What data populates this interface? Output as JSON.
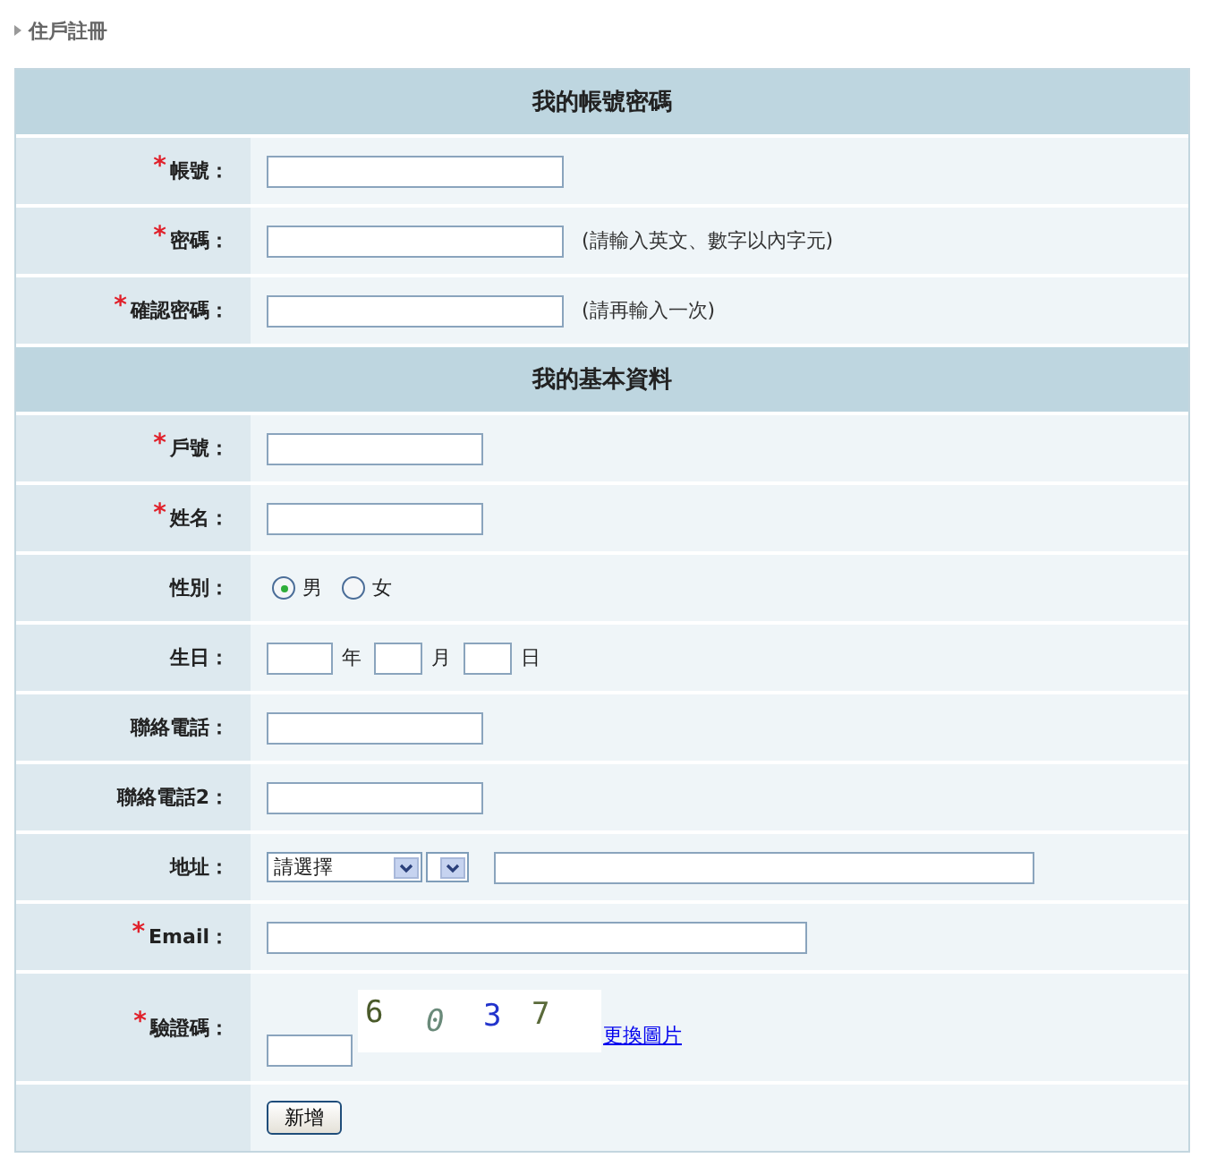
{
  "breadcrumb": {
    "title": "住戶註冊"
  },
  "sections": [
    {
      "title": "我的帳號密碼",
      "rows": [
        {
          "kind": "medium-text",
          "label": "帳號：",
          "marker": "*"
        },
        {
          "kind": "medium-text",
          "label": "密碼：",
          "marker": "*",
          "hint": "(請輸入英文、數字以內字元)"
        },
        {
          "kind": "medium-text",
          "label": "確認密碼：",
          "marker": "*",
          "hint": "(請再輸入一次)"
        }
      ]
    },
    {
      "title": "我的基本資料",
      "rows": [
        {
          "kind": "short-text",
          "label": "戶號：",
          "marker": "*"
        },
        {
          "kind": "short-text",
          "label": "姓名：",
          "marker": "*"
        },
        {
          "kind": "radio",
          "label": "性別：",
          "options": [
            {
              "label": "男",
              "selected": true
            },
            {
              "label": "女",
              "selected": false
            }
          ]
        },
        {
          "kind": "date",
          "label": "生日：",
          "parts": [
            {
              "unit": "年",
              "kind": "year"
            },
            {
              "unit": "月",
              "kind": "small"
            },
            {
              "unit": "日",
              "kind": "small"
            }
          ]
        },
        {
          "kind": "short-text",
          "label": "聯絡電話："
        },
        {
          "kind": "short-text",
          "label": "聯絡電話2："
        },
        {
          "kind": "address",
          "label": "地址：",
          "select_value": "請選擇"
        },
        {
          "kind": "long-text",
          "label": "Email：",
          "marker": "*"
        },
        {
          "kind": "captcha",
          "label": "驗證碼：",
          "marker": "*",
          "digits": [
            {
              "text": "6",
              "color": "#4a5a2a"
            },
            {
              "text": "0",
              "color": "#6a8a7a"
            },
            {
              "text": "3",
              "color": "#2233cc"
            },
            {
              "text": "7",
              "color": "#5a6a3a"
            }
          ],
          "link": "更換圖片"
        }
      ]
    }
  ],
  "submit": {
    "label": "新增"
  }
}
